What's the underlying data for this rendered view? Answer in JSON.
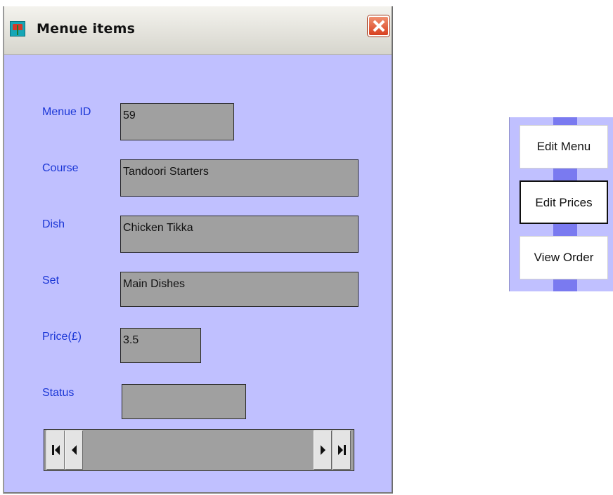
{
  "window": {
    "title": "Menue items",
    "icons": {
      "app": "app-icon",
      "close": "close-icon"
    }
  },
  "form": {
    "fields": [
      {
        "label": "Menue ID",
        "value": "59"
      },
      {
        "label": "Course",
        "value": "Tandoori Starters"
      },
      {
        "label": "Dish",
        "value": "Chicken Tikka"
      },
      {
        "label": "Set",
        "value": "Main Dishes"
      },
      {
        "label": "Price(£)",
        "value": "3.5"
      },
      {
        "label": "Status",
        "value": ""
      }
    ]
  },
  "navigator": {
    "icons": [
      "first-record-icon",
      "previous-record-icon",
      "next-record-icon",
      "last-record-icon"
    ]
  },
  "side_panel": {
    "buttons": [
      "Edit Menu",
      "Edit Prices",
      "View Order"
    ],
    "active": "Edit Prices"
  },
  "colors": {
    "form_background": "#c0c0ff",
    "label_text": "#1a36d6",
    "field_background": "#a0a0a0",
    "panel_stripe": "#7a7af0"
  }
}
